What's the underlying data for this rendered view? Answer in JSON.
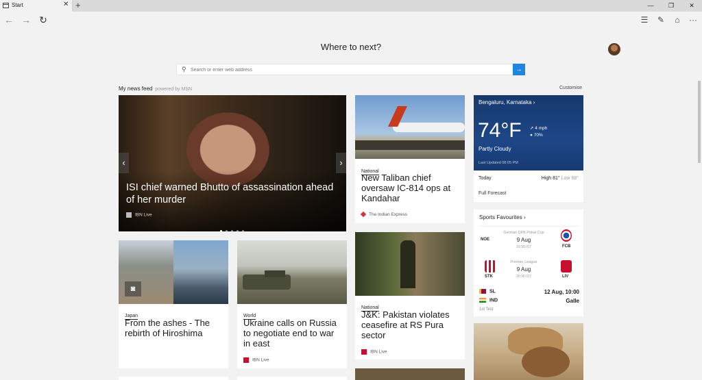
{
  "browser": {
    "tab_title": "Start",
    "tab_close": "✕",
    "new_tab": "+",
    "win_minimize": "—",
    "win_maximize": "❐",
    "win_close": "✕",
    "back": "←",
    "forward": "→",
    "refresh": "↻",
    "hub_icon": "☰",
    "note_icon": "✎",
    "share_icon": "⌂",
    "more_icon": "···"
  },
  "start": {
    "heading": "Where to next?",
    "search_placeholder": "Search or enter web address",
    "search_icon": "⚲",
    "go_icon": "→",
    "feed_label": "My news feed",
    "powered_by": "powered by MSN",
    "customise": "Customise"
  },
  "hero": {
    "title": "ISI chief warned Bhutto of assassination ahead of her murder",
    "source": "IBN Live",
    "prev": "‹",
    "next": "›",
    "slides": 5,
    "active_slide": 1
  },
  "articles": [
    {
      "category": "National",
      "headline": "New Taliban chief oversaw IC-814 ops at Kandahar",
      "source": "The Indian Express"
    },
    {
      "category": "National",
      "headline": "J&K: Pakistan violates ceasefire at RS Pura sector",
      "source": "IBN Live"
    },
    {
      "category": "Japan",
      "headline": "From the ashes - The rebirth of Hiroshima",
      "source": ""
    },
    {
      "category": "World",
      "headline": "Ukraine calls on Russia to negotiate end to war in east",
      "source": "IBN Live"
    }
  ],
  "weather": {
    "location": "Bengaluru, Karnataka",
    "chevron": "›",
    "temp": "74°F",
    "condition": "Partly Cloudy",
    "wind": "4 mph",
    "humidity": "70%",
    "updated": "Last Updated 08:05 PM",
    "today_label": "Today",
    "high": "High 81°",
    "low": "Low 68°",
    "full_forecast": "Full Forecast"
  },
  "sports": {
    "title": "Sports Favourites",
    "chevron": "›",
    "matches": [
      {
        "home": "NOE",
        "away": "FCB",
        "league": "German DFB Pokal Cup",
        "date": "9 Aug",
        "time": "19:30 IST"
      },
      {
        "home": "STK",
        "away": "LIV",
        "league": "Premier League",
        "date": "9 Aug",
        "time": "20:30 IST"
      }
    ],
    "cricket": {
      "team1": "SL",
      "team2": "IND",
      "datetime": "12 Aug, 10:00",
      "venue": "Galle",
      "format": "1st Test"
    }
  },
  "colors": {
    "accent": "#1e86e0",
    "weather_bg": "#1e4788",
    "page_bg": "#f2f2f2"
  }
}
